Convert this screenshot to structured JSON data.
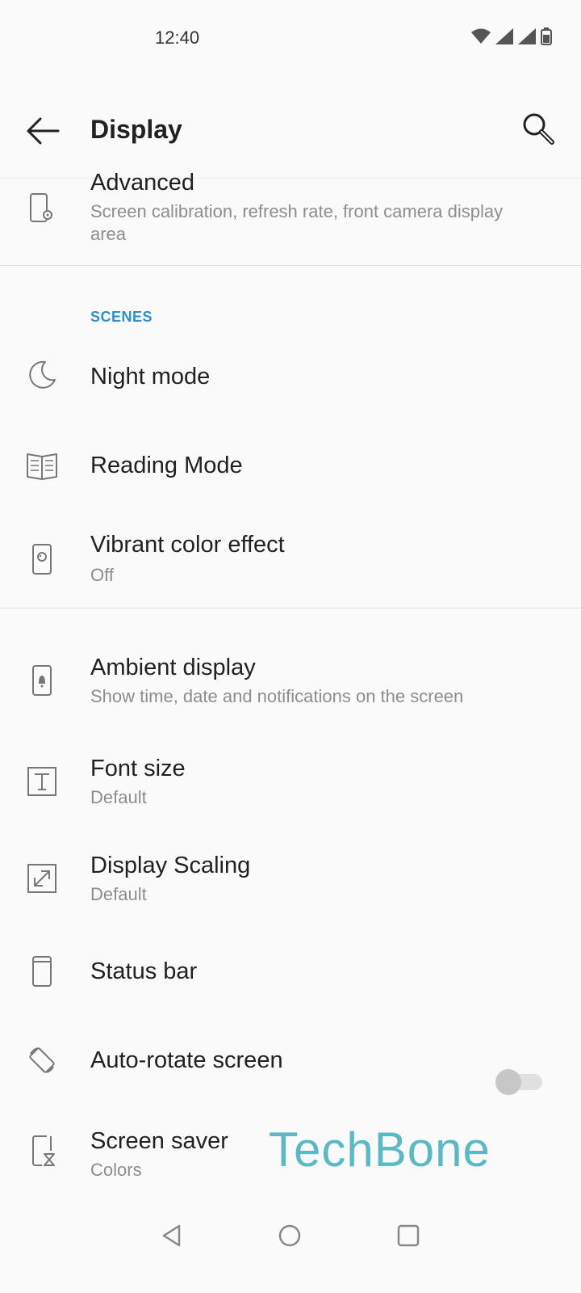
{
  "status_bar": {
    "time": "12:40",
    "icons": [
      "wifi-icon",
      "cell-signal-icon",
      "cell-signal-icon",
      "battery-icon"
    ]
  },
  "top_bar": {
    "title": "Display",
    "back_icon": "arrow-left-icon",
    "search_icon": "search-icon"
  },
  "items_top": [
    {
      "title": "Advanced",
      "summary": "Screen calibration, refresh rate, front camera display area",
      "icon": "phone-settings-icon"
    }
  ],
  "scenes": {
    "header": "SCENES",
    "items": [
      {
        "title": "Night mode",
        "icon": "moon-icon"
      },
      {
        "title": "Reading Mode",
        "icon": "book-icon"
      },
      {
        "title": "Vibrant color effect",
        "summary": "Off",
        "icon": "phone-palette-icon"
      }
    ]
  },
  "items_bottom": [
    {
      "title": "Ambient display",
      "summary": "Show time, date and notifications on the screen",
      "icon": "phone-bell-icon"
    },
    {
      "title": "Font size",
      "summary": "Default",
      "icon": "text-box-icon"
    },
    {
      "title": "Display Scaling",
      "summary": "Default",
      "icon": "resize-icon"
    },
    {
      "title": "Status bar",
      "icon": "phone-outline-icon"
    },
    {
      "title": "Auto-rotate screen",
      "icon": "rotate-icon",
      "toggle_on": false
    },
    {
      "title": "Screen saver",
      "summary": "Colors",
      "icon": "phone-hourglass-icon"
    }
  ],
  "watermark": "TechBone",
  "nav_bar": {
    "icons": [
      "nav-back-icon",
      "nav-home-icon",
      "nav-recents-icon"
    ]
  },
  "colors": {
    "accent": "#2f8fcb",
    "background": "#fafafa",
    "watermark": "#5bb9c6"
  }
}
